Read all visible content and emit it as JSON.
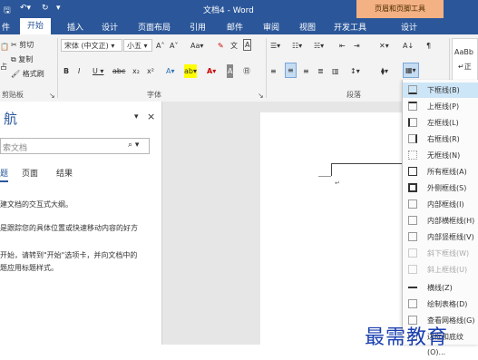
{
  "titlebar": {
    "title": "文档4 - Word",
    "context_group": "页眉和页脚工具"
  },
  "tabs": [
    "件",
    "开始",
    "插入",
    "设计",
    "页面布局",
    "引用",
    "邮件",
    "审阅",
    "视图",
    "开发工具",
    "设计"
  ],
  "ribbon": {
    "clipboard": {
      "cut": "剪切",
      "copy": "复制",
      "format_painter": "格式刷",
      "paste_partial": "占",
      "label": "剪贴板"
    },
    "font": {
      "name": "宋体 (中文正)",
      "size": "小五",
      "label": "字体"
    },
    "paragraph": {
      "label": "段落"
    },
    "styles": {
      "preview": "AaBb",
      "name_partial": "↵正"
    }
  },
  "nav": {
    "title": "航",
    "search_placeholder": "索文档",
    "tabs": [
      "题",
      "页面",
      "结果"
    ],
    "help1": "建文档的交互式大纲。",
    "help2": "是跟踪您的具体位置或快速移动内容的好方",
    "help3a": "开始，请转到\"开始\"选项卡，并向文档中的",
    "help3b": "题应用标题样式。"
  },
  "menu": {
    "items": [
      "下框线(B)",
      "上框线(P)",
      "左框线(L)",
      "右框线(R)",
      "无框线(N)",
      "所有框线(A)",
      "外侧框线(S)",
      "内部框线(I)",
      "内部横框线(H)",
      "内部竖框线(V)",
      "斜下框线(W)",
      "斜上框线(U)",
      "横线(Z)",
      "绘制表格(D)",
      "查看网格线(G)",
      "边框和底纹(O)..."
    ]
  },
  "watermark": "最需教育"
}
